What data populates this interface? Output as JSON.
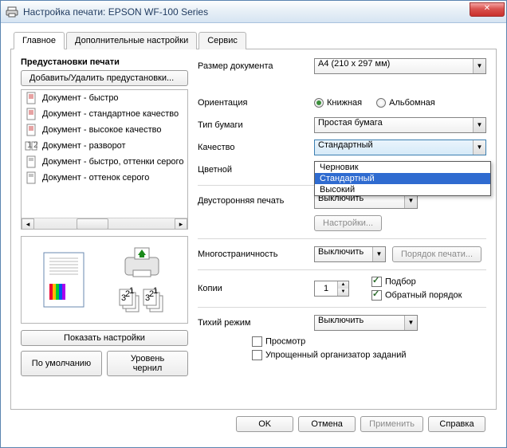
{
  "window": {
    "title": "Настройка печати: EPSON WF-100 Series"
  },
  "tabs": [
    "Главное",
    "Дополнительные настройки",
    "Сервис"
  ],
  "active_tab": 0,
  "presets": {
    "title": "Предустановки печати",
    "edit_button": "Добавить/Удалить предустановки...",
    "items": [
      "Документ - быстро",
      "Документ - стандартное качество",
      "Документ - высокое качество",
      "Документ - разворот",
      "Документ - быстро, оттенки серого",
      "Документ - оттенок серого"
    ]
  },
  "left_buttons": {
    "show_settings": "Показать настройки",
    "defaults": "По умолчанию",
    "ink_levels": "Уровень чернил"
  },
  "fields": {
    "doc_size": {
      "label": "Размер документа",
      "value": "A4 (210 x 297 мм)"
    },
    "orientation": {
      "label": "Ориентация",
      "portrait": "Книжная",
      "landscape": "Альбомная",
      "selected": "portrait"
    },
    "paper_type": {
      "label": "Тип бумаги",
      "value": "Простая бумага"
    },
    "quality": {
      "label": "Качество",
      "value": "Стандартный",
      "options": [
        "Черновик",
        "Стандартный",
        "Высокий"
      ]
    },
    "color": {
      "label": "Цветной"
    },
    "duplex": {
      "label": "Двусторонняя печать",
      "value": "Выключить",
      "settings_btn": "Настройки..."
    },
    "multipage": {
      "label": "Многостраничность",
      "value": "Выключить",
      "order_btn": "Порядок печати..."
    },
    "copies": {
      "label": "Копии",
      "value": "1",
      "collate": "Подбор",
      "reverse": "Обратный порядок"
    },
    "quiet": {
      "label": "Тихий режим",
      "value": "Выключить"
    },
    "preview": "Просмотр",
    "simplified": "Упрощенный организатор заданий"
  },
  "footer": {
    "ok": "OK",
    "cancel": "Отмена",
    "apply": "Применить",
    "help": "Справка"
  }
}
